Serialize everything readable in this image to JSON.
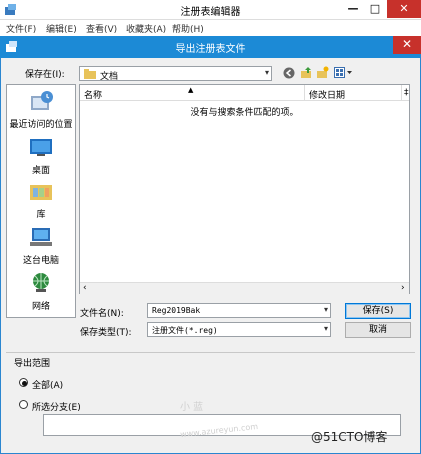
{
  "regedit": {
    "title": "注册表编辑器",
    "menu": [
      "文件(F)",
      "编辑(E)",
      "查看(V)",
      "收藏夹(A)",
      "帮助(H)"
    ],
    "controls": {
      "minimize": "—",
      "maximize": "□",
      "close": "✕"
    }
  },
  "dialog": {
    "title": "导出注册表文件",
    "close": "✕",
    "save_in_label": "保存在(I):",
    "save_in_value": "文档",
    "columns": [
      "名称",
      "修改日期",
      "‡"
    ],
    "empty_message": "没有与搜索条件匹配的项。",
    "places": [
      {
        "icon": "recent-places-icon",
        "label": "最近访问的位置"
      },
      {
        "icon": "desktop-icon",
        "label": "桌面"
      },
      {
        "icon": "library-icon",
        "label": "库"
      },
      {
        "icon": "this-pc-icon",
        "label": "这台电脑"
      },
      {
        "icon": "network-icon",
        "label": "网络"
      }
    ],
    "filename_label": "文件名(N):",
    "filename_value": "Reg2019Bak",
    "filetype_label": "保存类型(T):",
    "filetype_value": "注册文件(*.reg)",
    "save_button": "保存(S)",
    "cancel_button": "取消",
    "export_range": {
      "title": "导出范围",
      "all_label": "全部(A)",
      "branch_label": "所选分支(E)",
      "selected": "all"
    }
  },
  "watermark": {
    "site": "www.azureyun.com",
    "sig": "小 蓝",
    "blog": "@51CTO博客"
  }
}
